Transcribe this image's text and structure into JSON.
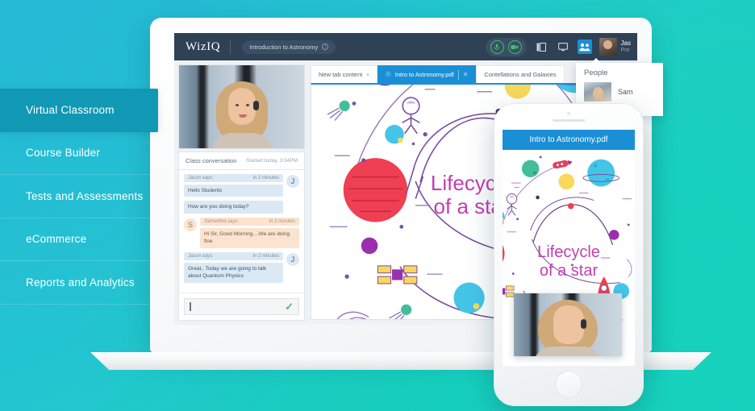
{
  "background": {
    "accent_teal": "#20c6c6",
    "accent_blue": "#23bcd4"
  },
  "sidebar": {
    "items": [
      {
        "label": "Virtual Classroom",
        "active": true
      },
      {
        "label": "Course Builder",
        "active": false
      },
      {
        "label": "Tests and Assessments",
        "active": false
      },
      {
        "label": "eCommerce",
        "active": false
      },
      {
        "label": "Reports and Analytics",
        "active": false
      }
    ]
  },
  "app": {
    "brand": "WizIQ",
    "course_pill": "Introduction to Astronomy",
    "course_pill_info_glyph": "i",
    "toolbar": {
      "mic_icon": "microphone-icon",
      "camera_icon": "video-camera-icon",
      "layout_icon": "layout-panel-icon",
      "screenshare_icon": "screen-share-icon",
      "people_icon": "people-icon"
    },
    "user": {
      "name": "Jas",
      "role": "Pre"
    }
  },
  "people_panel": {
    "title": "People",
    "members": [
      {
        "name": "Sam"
      }
    ]
  },
  "tabs": [
    {
      "label": "New tab content",
      "active": false,
      "has_chevron": true
    },
    {
      "label": "Intro to Astronomy.pdf",
      "active": true,
      "closable": true
    },
    {
      "label": "Contellations and Galaxies",
      "active": false
    }
  ],
  "chat": {
    "header_title": "Class conversation",
    "header_time": "Started today, 3:34PM",
    "messages": [
      {
        "who": "Jason says:",
        "time": "in 2 minutes",
        "text": "Hello Students",
        "tone": "blue",
        "avatar": "J"
      },
      {
        "who": "",
        "time": "",
        "text": "How are you doing today?",
        "tone": "blue",
        "avatar": ""
      },
      {
        "who": "Samantha says:",
        "time": "in 2 minutes",
        "text": "Hi Sir, Good Morning....We are doing fine",
        "tone": "orange",
        "avatar": "S"
      },
      {
        "who": "Jason says:",
        "time": "in 2 minutes",
        "text": "Great.. Today we are going to talk about Quantum Physics",
        "tone": "blue",
        "avatar": "J"
      }
    ],
    "input_value": "",
    "input_placeholder": "",
    "send_glyph": "check-icon"
  },
  "slide": {
    "title_line1": "Lifecycle",
    "title_line2": "of a star",
    "title_color": "#c43fb0"
  },
  "phone": {
    "tab_label": "Intro to Astronomy.pdf",
    "title_line1": "Lifecycle",
    "title_line2": "of a star"
  }
}
